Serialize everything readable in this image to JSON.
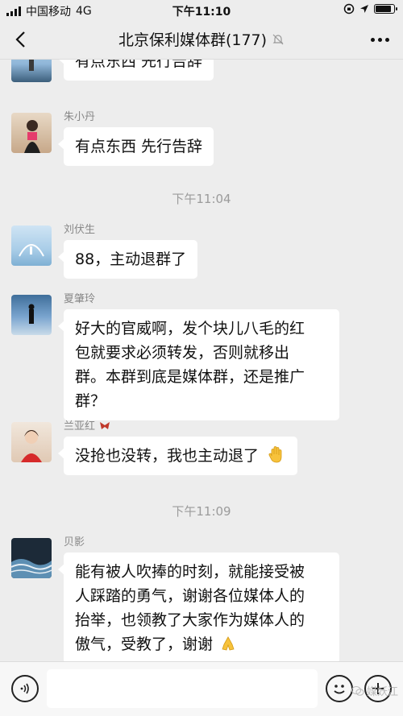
{
  "status_bar": {
    "carrier": "中国移动",
    "network": "4G",
    "time": "下午11:10"
  },
  "nav": {
    "title": "北京保利媒体群(177)"
  },
  "messages": [
    {
      "sender": "",
      "text": "有点东西 先行告辞"
    },
    {
      "sender": "朱小丹",
      "text": "有点东西 先行告辞"
    },
    {
      "sender": "刘伏生",
      "text": "88，主动退群了"
    },
    {
      "sender": "夏肇玲",
      "lines": [
        "好大的官威啊，发个块儿八毛的红",
        "包就要求必须转发，否则就移出",
        "群。本群到底是媒体群，还是推广",
        "群？"
      ]
    },
    {
      "sender": "兰亚红",
      "text": "没抢也没转，我也主动退了"
    },
    {
      "sender": "贝影",
      "lines": [
        "能有被人吹捧的时刻，就能接受被",
        "人踩踏的勇气，谢谢各位媒体人的",
        "抬举，也领教了大家作为媒体人的",
        "傲气，受教了，谢谢"
      ]
    }
  ],
  "time_separators": [
    "下午11:04",
    "下午11:09"
  ],
  "watermark": "媒妖江",
  "colors": {
    "background": "#ededed",
    "bubble": "#ffffff",
    "meta_text": "#9b9b9b"
  }
}
